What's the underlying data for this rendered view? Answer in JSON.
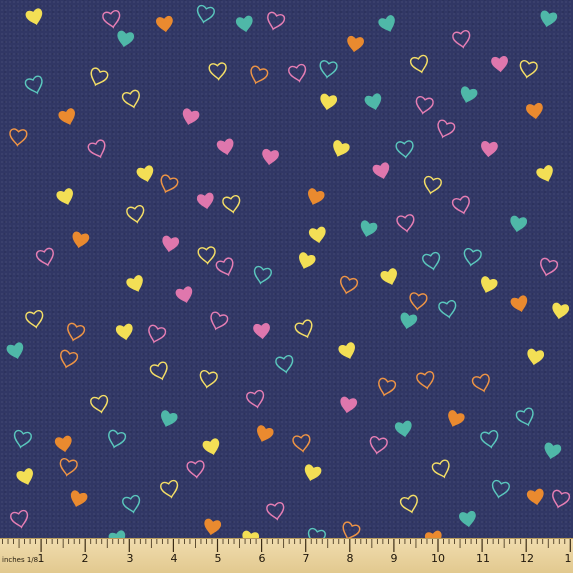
{
  "image": {
    "background_color": "#313765",
    "pattern": "scattered-hearts"
  },
  "hearts": {
    "colors": {
      "yellow": "#f3df55",
      "teal": "#4fb8a8",
      "orange": "#ea8a2f",
      "pink": "#df77ad",
      "outline_yellow": "#f4de66",
      "outline_teal": "#5ac7bd",
      "outline_orange": "#ee9445",
      "outline_pink": "#e67eb4"
    }
  },
  "ruler": {
    "unit_label": "inches 1/8",
    "numbers": [
      "1",
      "2",
      "3",
      "4",
      "5",
      "6",
      "7",
      "8",
      "9",
      "10",
      "11",
      "12",
      "1"
    ],
    "color": "#e8d09a"
  }
}
